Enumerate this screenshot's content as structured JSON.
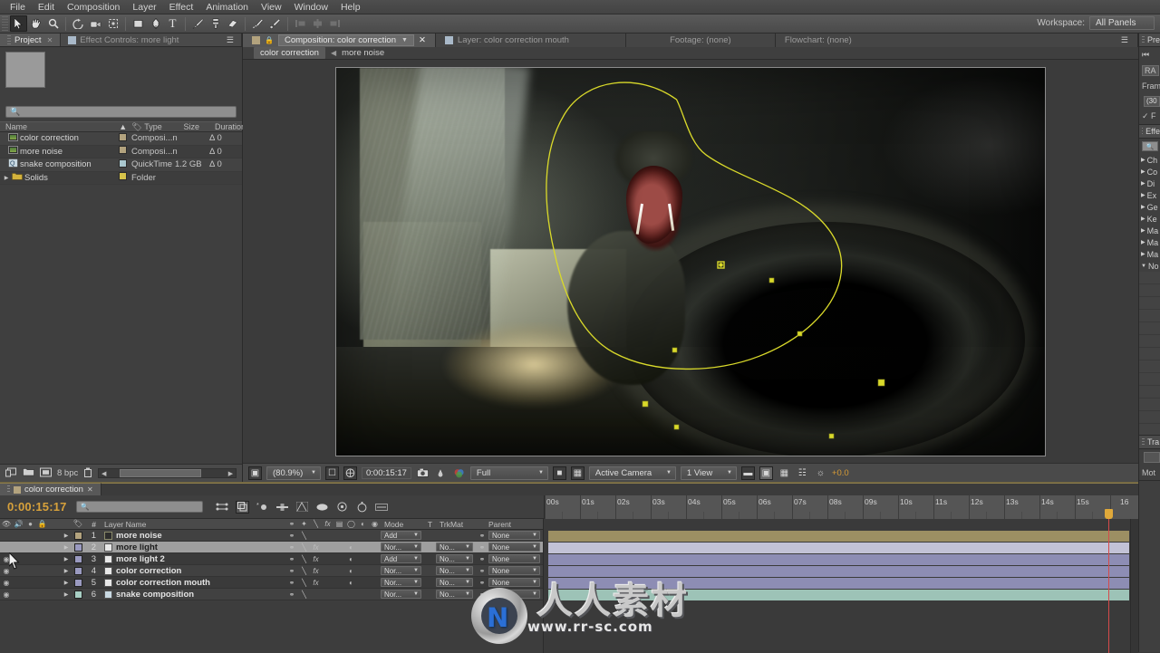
{
  "menu": {
    "items": [
      "File",
      "Edit",
      "Composition",
      "Layer",
      "Effect",
      "Animation",
      "View",
      "Window",
      "Help"
    ]
  },
  "toolbar": {
    "tools": [
      {
        "name": "selection-tool",
        "glyph": "↖",
        "selected": true
      },
      {
        "name": "hand-tool",
        "glyph": "✋",
        "selected": false
      },
      {
        "name": "zoom-tool",
        "glyph": "🔍",
        "selected": false
      },
      {
        "name": "rotation-tool",
        "glyph": "↻",
        "selected": false
      },
      {
        "name": "camera-tool",
        "glyph": "📷",
        "selected": false
      },
      {
        "name": "pan-behind-tool",
        "glyph": "⯀",
        "selected": false
      },
      {
        "name": "shape-tool",
        "glyph": "■",
        "selected": false
      },
      {
        "name": "pen-tool",
        "glyph": "✒",
        "selected": false
      },
      {
        "name": "type-tool",
        "glyph": "T",
        "selected": false
      },
      {
        "name": "brush-tool",
        "glyph": "╱",
        "selected": false
      },
      {
        "name": "clone-stamp-tool",
        "glyph": "☗",
        "selected": false
      },
      {
        "name": "eraser-tool",
        "glyph": "▱",
        "selected": false
      },
      {
        "name": "roto-brush-tool",
        "glyph": "✒",
        "selected": false
      },
      {
        "name": "puppet-pin-tool",
        "glyph": "✦",
        "selected": false
      }
    ],
    "workspace_label": "Workspace:",
    "workspace_value": "All Panels"
  },
  "project_panel": {
    "tabs": [
      {
        "label": "Project",
        "active": true,
        "closable": true
      },
      {
        "label": "Effect Controls: more light",
        "active": false,
        "closable": false
      }
    ],
    "search_placeholder": "",
    "columns": [
      "Name",
      "Type",
      "Size",
      "Duration"
    ],
    "items": [
      {
        "name": "color correction",
        "icon": "composition-icon",
        "swatch": "#b3a37e",
        "type": "Composi...n",
        "size": "",
        "duration": "Δ 0"
      },
      {
        "name": "more noise",
        "icon": "composition-icon",
        "swatch": "#b3a37e",
        "type": "Composi...n",
        "size": "",
        "duration": "Δ 0"
      },
      {
        "name": "snake composition",
        "icon": "footage-icon",
        "swatch": "#a9c7cf",
        "type": "QuickTime",
        "size": "1.2 GB",
        "duration": "Δ 0"
      },
      {
        "name": "Solids",
        "icon": "folder-icon",
        "swatch": "#d6c34a",
        "type": "Folder",
        "size": "",
        "duration": ""
      }
    ],
    "bottom": {
      "bit_depth": "8 bpc",
      "new_comp_icon": "new-composition-icon",
      "new_folder_icon": "new-folder-icon",
      "interpret_icon": "interpret-footage-icon",
      "delete_icon": "delete-icon"
    }
  },
  "composition_panel": {
    "tabs": [
      {
        "label": "Composition: color correction",
        "active": true
      },
      {
        "label": "Layer: color correction mouth",
        "active": false
      },
      {
        "label": "Footage: (none)",
        "active": false
      },
      {
        "label": "Flowchart: (none)",
        "active": false
      }
    ],
    "breadcrumb": [
      "color correction",
      "more noise"
    ],
    "bottom_bar": {
      "magnification": "(80.9%)",
      "timecode": "0:00:15:17",
      "resolution": "Full",
      "camera": "Active Camera",
      "views": "1 View",
      "exposure": "+0.0",
      "icons": [
        "always-preview-icon",
        "region-of-interest-icon",
        "toggle-mask-icon",
        "take-snapshot-icon",
        "show-snapshot-icon",
        "show-channel-icon",
        "toggle-transparency-grid-icon",
        "toggle-guides-icon",
        "toggle-pixel-aspect-icon",
        "fast-previews-icon",
        "timeline-icon",
        "flowchart-icon",
        "reset-exposure-icon"
      ]
    },
    "mask": {
      "color": "#d9d92a",
      "label": "mask-path"
    }
  },
  "right_sidebar": {
    "panels": [
      {
        "name": "preview-panel",
        "tab": "Pre",
        "rows": [
          "⏮",
          "RA",
          "Fram",
          "(30",
          "✓ F"
        ]
      },
      {
        "name": "effects-presets-panel",
        "tab": "Effe",
        "search": "",
        "categories": [
          "Ch",
          "Co",
          "Di",
          "Ex",
          "Ge",
          "Ke",
          "Ma",
          "Ma",
          "Ma",
          "No"
        ]
      },
      {
        "name": "tracker-panel",
        "tab": "Tra",
        "rows": [
          "Mot"
        ]
      }
    ]
  },
  "timeline": {
    "tab_label": "color correction",
    "current_time": "0:00:15:17",
    "search_placeholder": "",
    "switch_icons": [
      "live-update-icon",
      "draft-3d-icon",
      "hide-shy-layers-icon",
      "frame-blending-icon",
      "motion-blur-icon",
      "graph-editor-icon",
      "brainstorm-icon",
      "auto-keyframe-icon",
      "motion-blur-toggle-icon"
    ],
    "columns": [
      "Layer Name",
      "Mode",
      "T",
      "TrkMat",
      "Parent"
    ],
    "ruler_labels": [
      "00s",
      "01s",
      "02s",
      "03s",
      "04s",
      "05s",
      "06s",
      "07s",
      "08s",
      "09s",
      "10s",
      "11s",
      "12s",
      "13s",
      "14s",
      "15s",
      "16"
    ],
    "layers": [
      {
        "num": "1",
        "name": "more noise",
        "swatch": "#b3a37e",
        "bar_color": "#9c8f63",
        "mode": "Add",
        "trkmat": "",
        "parent": "None",
        "visible": true,
        "selected": false,
        "has_fx": false,
        "has_matte": false,
        "icon": "composition-icon"
      },
      {
        "num": "2",
        "name": "more light",
        "swatch": "#9a9ac0",
        "bar_color": "#c2c2d6",
        "mode": "Nor...",
        "trkmat": "No...",
        "parent": "None",
        "visible": false,
        "selected": true,
        "has_fx": true,
        "has_matte": true,
        "icon": "solid-icon"
      },
      {
        "num": "3",
        "name": "more light 2",
        "swatch": "#9a9ac0",
        "bar_color": "#8d8db4",
        "mode": "Add",
        "trkmat": "No...",
        "parent": "None",
        "visible": true,
        "selected": false,
        "has_fx": true,
        "has_matte": true,
        "icon": "solid-icon"
      },
      {
        "num": "4",
        "name": "color correction",
        "swatch": "#9a9ac0",
        "bar_color": "#8d8db4",
        "mode": "Nor...",
        "trkmat": "No...",
        "parent": "None",
        "visible": true,
        "selected": false,
        "has_fx": true,
        "has_matte": true,
        "icon": "solid-icon"
      },
      {
        "num": "5",
        "name": "color correction mouth",
        "swatch": "#9a9ac0",
        "bar_color": "#8d8db4",
        "mode": "Nor...",
        "trkmat": "No...",
        "parent": "None",
        "visible": true,
        "selected": false,
        "has_fx": true,
        "has_matte": true,
        "icon": "solid-icon"
      },
      {
        "num": "6",
        "name": "snake composition",
        "swatch": "#a8cfc4",
        "bar_color": "#9dc3b7",
        "mode": "Nor...",
        "trkmat": "No...",
        "parent": "No",
        "visible": true,
        "selected": false,
        "has_fx": false,
        "has_matte": false,
        "icon": "footage-icon"
      }
    ]
  },
  "watermark": {
    "text": "人人素材",
    "url": "www.rr-sc.com",
    "logo_letter": "N"
  },
  "colors": {
    "accent_orange": "#d7a13b",
    "mask_yellow": "#d9d92a",
    "playhead_red": "#d54a4a",
    "panel_bg": "#3f3f3f"
  }
}
